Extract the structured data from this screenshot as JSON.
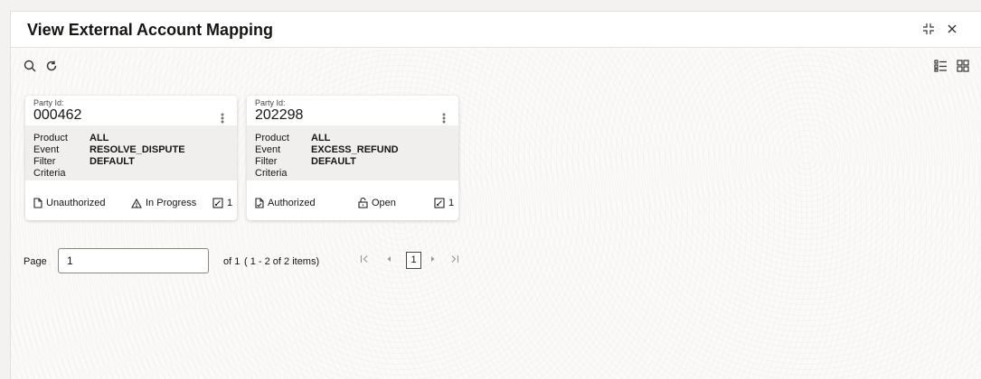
{
  "window": {
    "title": "View External Account Mapping"
  },
  "toolbar": {
    "search_icon": "search-icon",
    "refresh_icon": "refresh-icon"
  },
  "view": {
    "list_icon": "list-view-icon",
    "grid_icon": "grid-view-icon"
  },
  "cards": [
    {
      "party_label": "Party Id:",
      "party_id": "000462",
      "fields": [
        {
          "key": "Product",
          "value": "ALL"
        },
        {
          "key": "Event",
          "value": "RESOLVE_DISPUTE"
        },
        {
          "key": "Filter Criteria",
          "value": "DEFAULT"
        }
      ],
      "status": "Unauthorized",
      "lock_status": "In Progress",
      "modifications": "1"
    },
    {
      "party_label": "Party Id:",
      "party_id": "202298",
      "fields": [
        {
          "key": "Product",
          "value": "ALL"
        },
        {
          "key": "Event",
          "value": "EXCESS_REFUND"
        },
        {
          "key": "Filter Criteria",
          "value": "DEFAULT"
        }
      ],
      "status": "Authorized",
      "lock_status": "Open",
      "modifications": "1"
    }
  ],
  "pagination": {
    "page_label": "Page",
    "page_value": "1",
    "of_label": "of 1",
    "items_label": "( 1 - 2 of 2 items)",
    "current_page": "1"
  }
}
